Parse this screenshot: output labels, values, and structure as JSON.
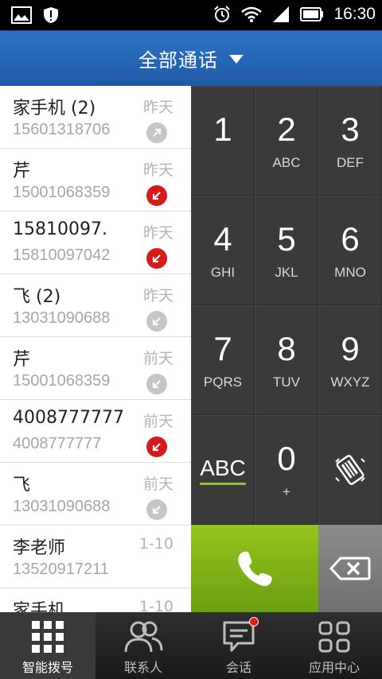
{
  "status": {
    "time": "16:30"
  },
  "header": {
    "title": "全部通话"
  },
  "calls": [
    {
      "name": "家手机 (2)",
      "number": "15601318706",
      "date": "昨天",
      "type": "outgoing"
    },
    {
      "name": "芹",
      "number": "15001068359",
      "date": "昨天",
      "type": "missed"
    },
    {
      "name": "15810097.",
      "number": "15810097042",
      "date": "昨天",
      "type": "missed"
    },
    {
      "name": "飞 (2)",
      "number": "13031090688",
      "date": "昨天",
      "type": "incoming"
    },
    {
      "name": "芹",
      "number": "15001068359",
      "date": "前天",
      "type": "incoming"
    },
    {
      "name": "4008777777",
      "number": "4008777777",
      "date": "前天",
      "type": "missed"
    },
    {
      "name": "飞",
      "number": "13031090688",
      "date": "前天",
      "type": "incoming"
    },
    {
      "name": "李老师",
      "number": "13520917211",
      "date": "1-10",
      "type": "none"
    },
    {
      "name": "家手机",
      "number": "",
      "date": "1-10",
      "type": "none"
    }
  ],
  "keypad": [
    {
      "digit": "1",
      "letters": ""
    },
    {
      "digit": "2",
      "letters": "ABC"
    },
    {
      "digit": "3",
      "letters": "DEF"
    },
    {
      "digit": "4",
      "letters": "GHI"
    },
    {
      "digit": "5",
      "letters": "JKL"
    },
    {
      "digit": "6",
      "letters": "MNO"
    },
    {
      "digit": "7",
      "letters": "PQRS"
    },
    {
      "digit": "8",
      "letters": "TUV"
    },
    {
      "digit": "9",
      "letters": "WXYZ"
    }
  ],
  "keypad_bottom": {
    "abc_label": "ABC",
    "zero_digit": "0",
    "zero_sub": "+"
  },
  "tabs": [
    {
      "label": "智能拨号",
      "icon": "grid-icon",
      "active": true
    },
    {
      "label": "联系人",
      "icon": "contacts-icon",
      "active": false
    },
    {
      "label": "会话",
      "icon": "chat-icon",
      "active": false
    },
    {
      "label": "应用中心",
      "icon": "apps-icon",
      "active": false
    }
  ],
  "colors": {
    "header": "#2a69b8",
    "call": "#7fb51a",
    "missed": "#d51a1a",
    "accent_underline": "#8bc33a"
  }
}
